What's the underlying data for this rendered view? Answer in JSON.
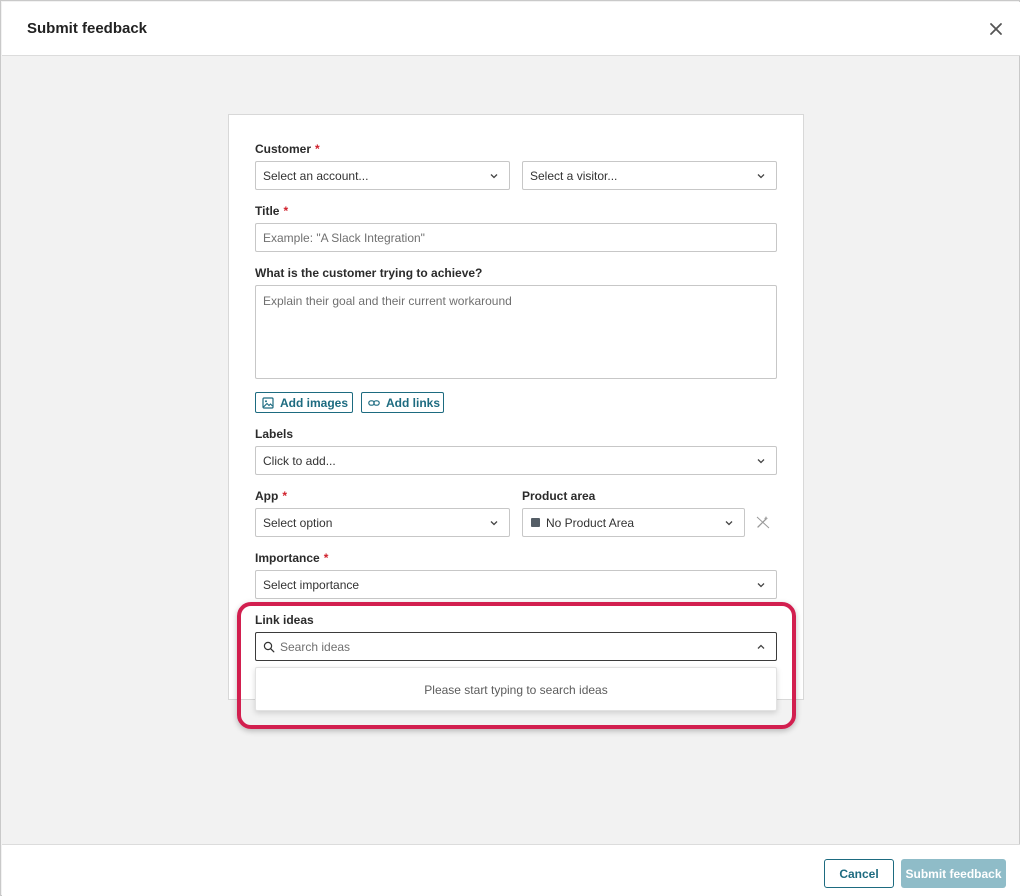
{
  "header": {
    "title": "Submit feedback",
    "close_icon": "close-icon"
  },
  "form": {
    "customer": {
      "label": "Customer",
      "required": "*",
      "account_placeholder": "Select an account...",
      "visitor_placeholder": "Select a visitor..."
    },
    "title": {
      "label": "Title",
      "required": "*",
      "placeholder": "Example: \"A Slack Integration\""
    },
    "goal": {
      "label": "What is the customer trying to achieve?",
      "placeholder": "Explain their goal and their current workaround"
    },
    "attachments": {
      "add_images": "Add images",
      "add_images_icon": "image-icon",
      "add_links": "Add links",
      "add_links_icon": "link-icon"
    },
    "labels": {
      "label": "Labels",
      "placeholder": "Click to add..."
    },
    "app": {
      "label": "App",
      "required": "*",
      "placeholder": "Select option"
    },
    "product_area": {
      "label": "Product area",
      "value": "No Product Area",
      "swatch_color": "#545d66",
      "suggest_icon": "magic-wand-icon"
    },
    "importance": {
      "label": "Importance",
      "required": "*",
      "placeholder": "Select importance"
    },
    "link_ideas": {
      "label": "Link ideas",
      "search_placeholder": "Search ideas",
      "empty_message": "Please start typing to search ideas",
      "expanded": true
    }
  },
  "footer": {
    "cancel_label": "Cancel",
    "submit_label": "Submit feedback"
  },
  "colors": {
    "accent": "#1d6b80",
    "submit_disabled": "#8fbcc8",
    "required": "#d0212c",
    "highlight": "#d21f4f"
  }
}
